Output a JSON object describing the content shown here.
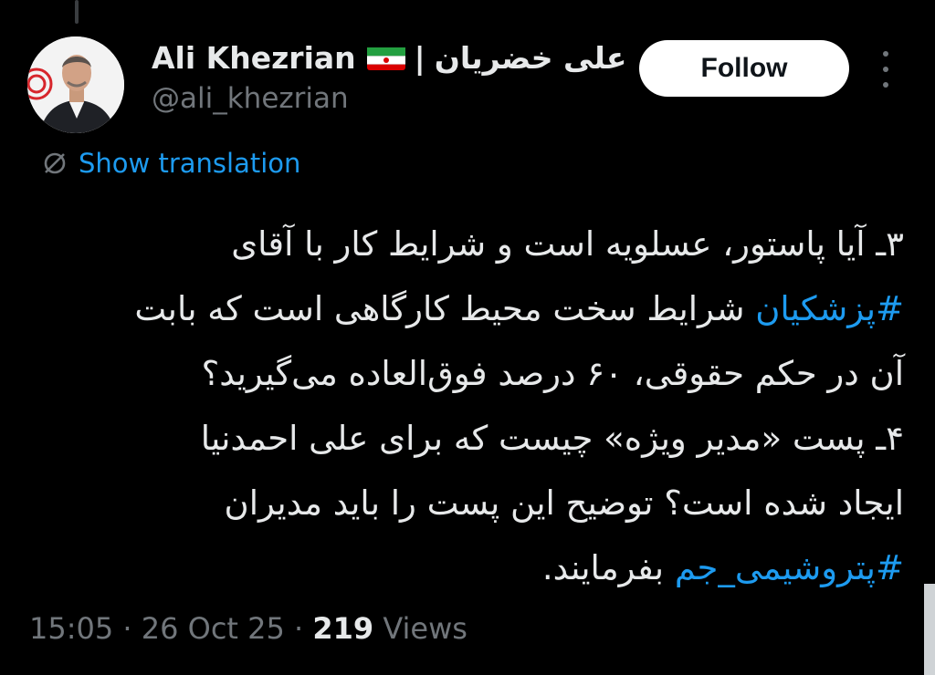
{
  "user": {
    "display_name": "Ali Khezrian",
    "flag_icon": "iran-flag-icon",
    "separator": "|",
    "name_fa": "علی خضریان",
    "handle": "@ali_khezrian"
  },
  "actions": {
    "follow_label": "Follow",
    "more_icon": "more-icon"
  },
  "translation": {
    "label": "Show translation",
    "icon": "translate-icon"
  },
  "tweet": {
    "line1": "۳ـ آیا پاستور، عسلویه است و شرایط کار با آقای",
    "line2_hashtag": "#پزشکیان",
    "line2_rest": " شرایط سخت محیط کارگاهی است که بابت",
    "line3": "آن در حکم حقوقی، ۶۰ درصد فوق‌العاده می‌گیرید؟",
    "line4": "۴ـ پست «مدیر ویژه» چیست که برای علی احمدنیا",
    "line5": "ایجاد شده است؟ توضیح این پست را باید مدیران",
    "line6_hashtag": "#پتروشیمی_جم",
    "line6_rest": " بفرمایند."
  },
  "meta": {
    "time": "15:05",
    "dot": " · ",
    "date": "26 Oct 25",
    "views_count": "219",
    "views_label": " Views"
  },
  "colors": {
    "background": "#000000",
    "accent": "#1d9bf0",
    "text": "#e7e9ea",
    "muted": "#71767b"
  }
}
